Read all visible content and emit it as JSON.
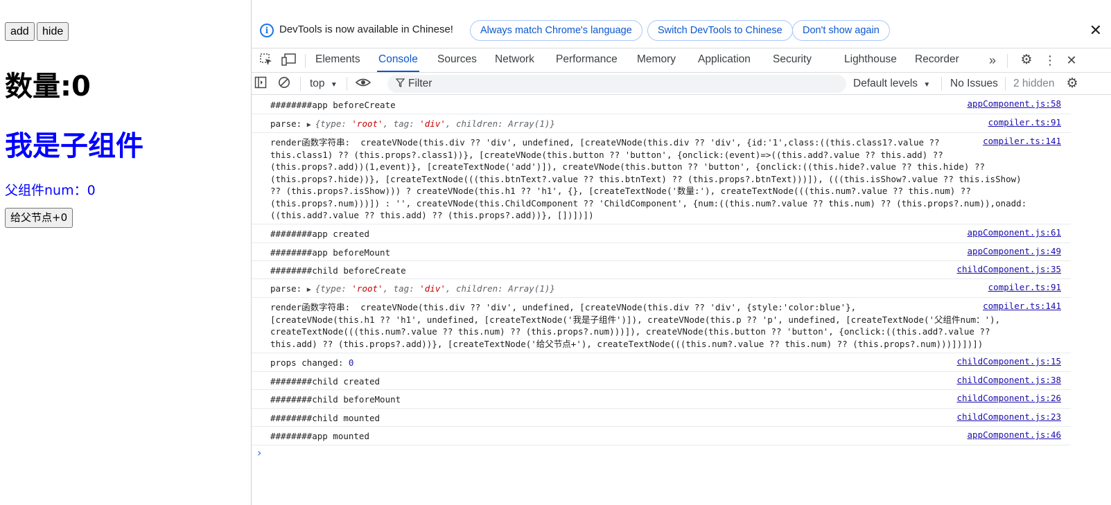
{
  "page": {
    "add_button": "add",
    "hide_button": "hide",
    "count_heading": "数量:0",
    "child_heading": "我是子组件",
    "child_num": "父组件num：0",
    "parent_button": "给父节点+0"
  },
  "infobar": {
    "message": "DevTools is now available in Chinese!",
    "btn_match": "Always match Chrome's language",
    "btn_switch": "Switch DevTools to Chinese",
    "btn_dont": "Don't show again",
    "close": "✕"
  },
  "tabs": [
    "Elements",
    "Console",
    "Sources",
    "Network",
    "Performance",
    "Memory",
    "Application",
    "Security",
    "Lighthouse",
    "Recorder"
  ],
  "toolbar": {
    "context": "top",
    "filter_placeholder": "Filter",
    "levels": "Default levels",
    "issues": "No Issues",
    "hidden": "2 hidden"
  },
  "colors": {
    "accent": "#0b57d0",
    "link": "#1a0dab",
    "child_text": "#0000ff"
  },
  "console": [
    {
      "text": "########app beforeCreate",
      "source": "appComponent.js:58"
    },
    {
      "text": "parse: ",
      "source": "compiler.ts:91",
      "object": {
        "type": "'root'",
        "tag": "'div'",
        "children": "Array(1)"
      }
    },
    {
      "text": "render函数字符串:  createVNode(this.div ?? 'div', undefined, [createVNode(this.div ?? 'div', {id:'1',class:((this.class1?.value ??\nthis.class1) ?? (this.props?.class1))}, [createVNode(this.button ?? 'button', {onclick:(event)=>((this.add?.value ?? this.add) ??\n(this.props?.add))(1,event)}, [createTextNode('add')]), createVNode(this.button ?? 'button', {onclick:((this.hide?.value ?? this.hide) ??\n(this.props?.hide))}, [createTextNode(((this.btnText?.value ?? this.btnText) ?? (this.props?.btnText)))]), (((this.isShow?.value ?? this.isShow)\n?? (this.props?.isShow))) ? createVNode(this.h1 ?? 'h1', {}, [createTextNode('数量:'), createTextNode(((this.num?.value ?? this.num) ??\n(this.props?.num)))]) : '', createVNode(this.ChildComponent ?? 'ChildComponent', {num:((this.num?.value ?? this.num) ?? (this.props?.num)),onadd:\n((this.add?.value ?? this.add) ?? (this.props?.add))}, [])])])",
      "source": "compiler.ts:141"
    },
    {
      "text": "########app created",
      "source": "appComponent.js:61"
    },
    {
      "text": "########app beforeMount",
      "source": "appComponent.js:49"
    },
    {
      "text": "########child beforeCreate",
      "source": "childComponent.js:35"
    },
    {
      "text": "parse: ",
      "source": "compiler.ts:91",
      "object": {
        "type": "'root'",
        "tag": "'div'",
        "children": "Array(1)"
      }
    },
    {
      "text": "render函数字符串:  createVNode(this.div ?? 'div', undefined, [createVNode(this.div ?? 'div', {style:'color:blue'},\n[createVNode(this.h1 ?? 'h1', undefined, [createTextNode('我是子组件')]), createVNode(this.p ?? 'p', undefined, [createTextNode('父组件num：'),\ncreateTextNode(((this.num?.value ?? this.num) ?? (this.props?.num)))]), createVNode(this.button ?? 'button', {onclick:((this.add?.value ??\nthis.add) ?? (this.props?.add))}, [createTextNode('给父节点+'), createTextNode(((this.num?.value ?? this.num) ?? (this.props?.num)))])])])",
      "source": "compiler.ts:141"
    },
    {
      "text": "props changed: ",
      "value": "0",
      "source": "childComponent.js:15"
    },
    {
      "text": "########child created",
      "source": "childComponent.js:38"
    },
    {
      "text": "########child beforeMount",
      "source": "childComponent.js:26"
    },
    {
      "text": "########child mounted",
      "source": "childComponent.js:23"
    },
    {
      "text": "########app mounted",
      "source": "appComponent.js:46"
    }
  ]
}
